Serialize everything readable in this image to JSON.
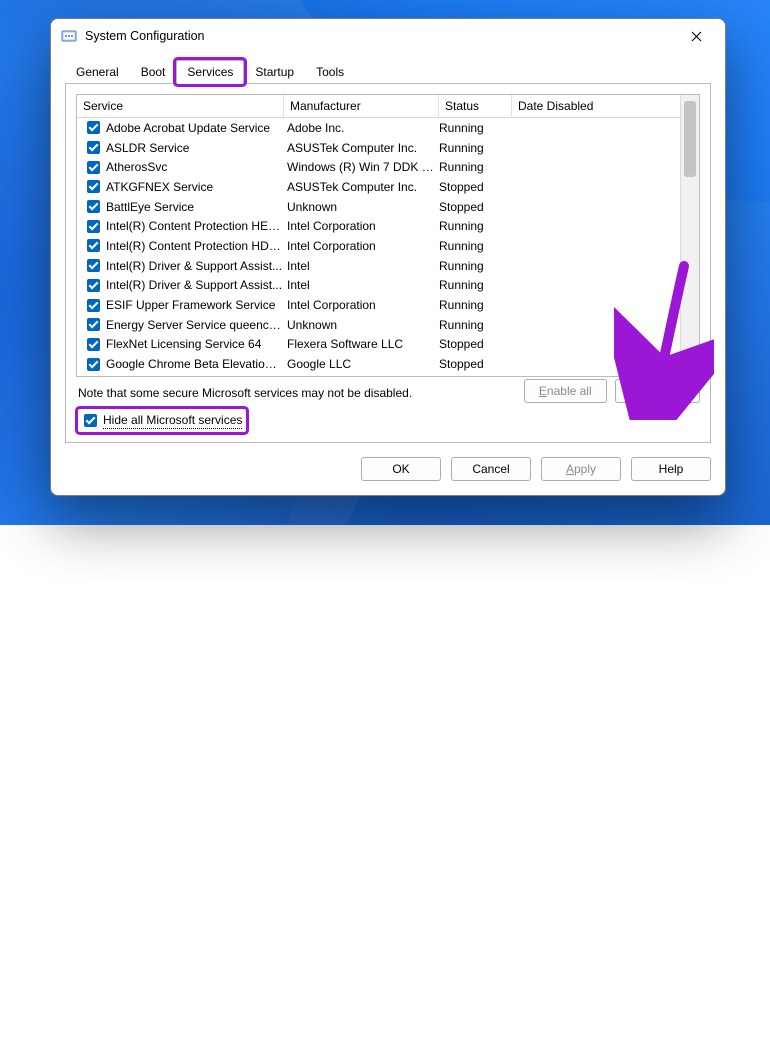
{
  "window": {
    "title": "System Configuration"
  },
  "tabs": {
    "items": [
      {
        "label": "General",
        "active": false
      },
      {
        "label": "Boot",
        "active": false
      },
      {
        "label": "Services",
        "active": true,
        "highlighted": true
      },
      {
        "label": "Startup",
        "active": false
      },
      {
        "label": "Tools",
        "active": false
      }
    ]
  },
  "columns": {
    "service": "Service",
    "manufacturer": "Manufacturer",
    "status": "Status",
    "date_disabled": "Date Disabled"
  },
  "services": [
    {
      "checked": true,
      "name": "Adobe Acrobat Update Service",
      "manufacturer": "Adobe Inc.",
      "status": "Running"
    },
    {
      "checked": true,
      "name": "ASLDR Service",
      "manufacturer": "ASUSTek Computer Inc.",
      "status": "Running"
    },
    {
      "checked": true,
      "name": "AtherosSvc",
      "manufacturer": "Windows (R) Win 7 DDK p...",
      "status": "Running"
    },
    {
      "checked": true,
      "name": "ATKGFNEX Service",
      "manufacturer": "ASUSTek Computer Inc.",
      "status": "Stopped"
    },
    {
      "checked": true,
      "name": "BattlEye Service",
      "manufacturer": "Unknown",
      "status": "Stopped"
    },
    {
      "checked": true,
      "name": "Intel(R) Content Protection HECI...",
      "manufacturer": "Intel Corporation",
      "status": "Running"
    },
    {
      "checked": true,
      "name": "Intel(R) Content Protection HDC...",
      "manufacturer": "Intel Corporation",
      "status": "Running"
    },
    {
      "checked": true,
      "name": "Intel(R) Driver & Support Assist...",
      "manufacturer": "Intel",
      "status": "Running"
    },
    {
      "checked": true,
      "name": "Intel(R) Driver & Support Assist...",
      "manufacturer": "Intel",
      "status": "Running"
    },
    {
      "checked": true,
      "name": "ESIF Upper Framework Service",
      "manufacturer": "Intel Corporation",
      "status": "Running"
    },
    {
      "checked": true,
      "name": "Energy Server Service queencreek",
      "manufacturer": "Unknown",
      "status": "Running"
    },
    {
      "checked": true,
      "name": "FlexNet Licensing Service 64",
      "manufacturer": "Flexera Software LLC",
      "status": "Stopped"
    },
    {
      "checked": true,
      "name": "Google Chrome Beta Elevation S...",
      "manufacturer": "Google LLC",
      "status": "Stopped"
    }
  ],
  "note": "Note that some secure Microsoft services may not be disabled.",
  "action_buttons": {
    "enable_all_prefix": "E",
    "enable_all_rest": "nable all",
    "enable_all_enabled": false,
    "disable_all_prefix": "D",
    "disable_all_rest": "isable all",
    "disable_all_enabled": true
  },
  "hide_ms": {
    "checked": true,
    "label": "Hide all Microsoft services",
    "highlighted": true
  },
  "dialog_buttons": {
    "ok": "OK",
    "cancel": "Cancel",
    "apply_prefix": "A",
    "apply_rest": "pply",
    "apply_enabled": false,
    "help": "Help"
  },
  "accent_color": "#9a17d6"
}
